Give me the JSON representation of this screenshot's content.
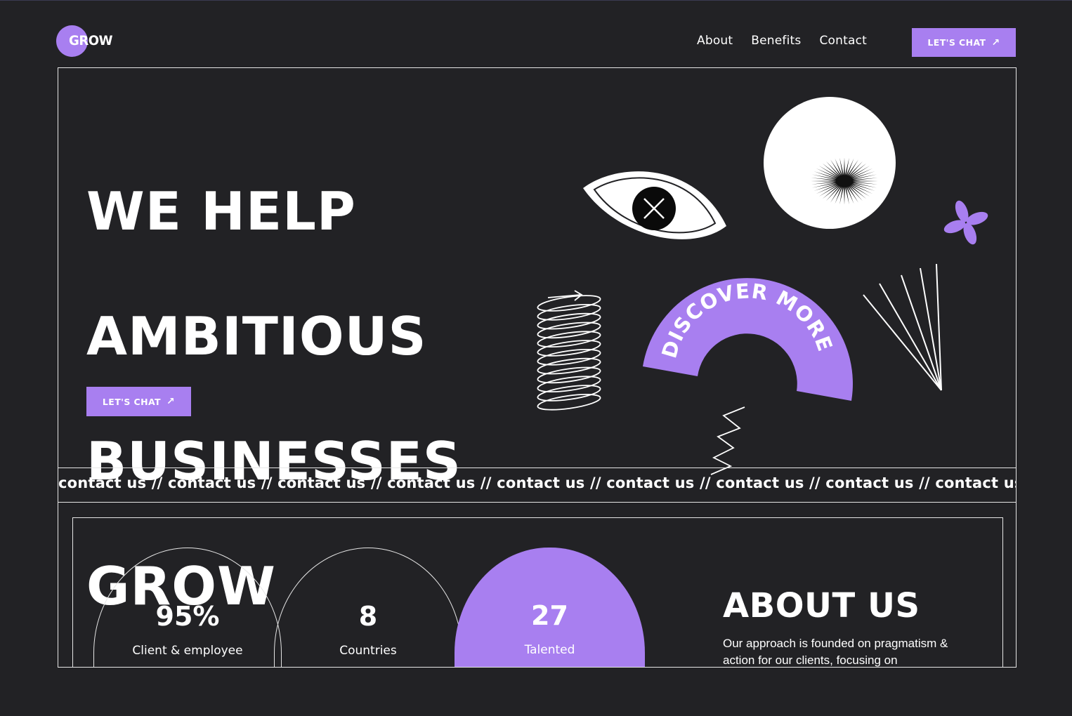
{
  "brand": {
    "name": "GROW",
    "accent": "#a87ff0",
    "background": "#222225"
  },
  "nav": {
    "items": [
      "About",
      "Benefits",
      "Contact"
    ],
    "cta_label": "LET'S CHAT",
    "cta_icon": "arrow-up-right-icon"
  },
  "hero": {
    "headline_lines": [
      "WE HELP",
      "AMBITIOUS",
      "BUSINESSES",
      "GROW"
    ],
    "cta_label": "LET'S CHAT",
    "badge_text": "DISCOVER MORE"
  },
  "marquee": {
    "text": "contact us // contact us // contact us // contact us // contact us // contact us // contact us // contact us //  contact us"
  },
  "stats": [
    {
      "value": "95%",
      "label": "Client & employee"
    },
    {
      "value": "8",
      "label": "Countries"
    },
    {
      "value": "27",
      "label": "Talented"
    }
  ],
  "about": {
    "title": "ABOUT US",
    "text": "Our approach is founded on pragmatism & action for our clients, focusing on"
  }
}
